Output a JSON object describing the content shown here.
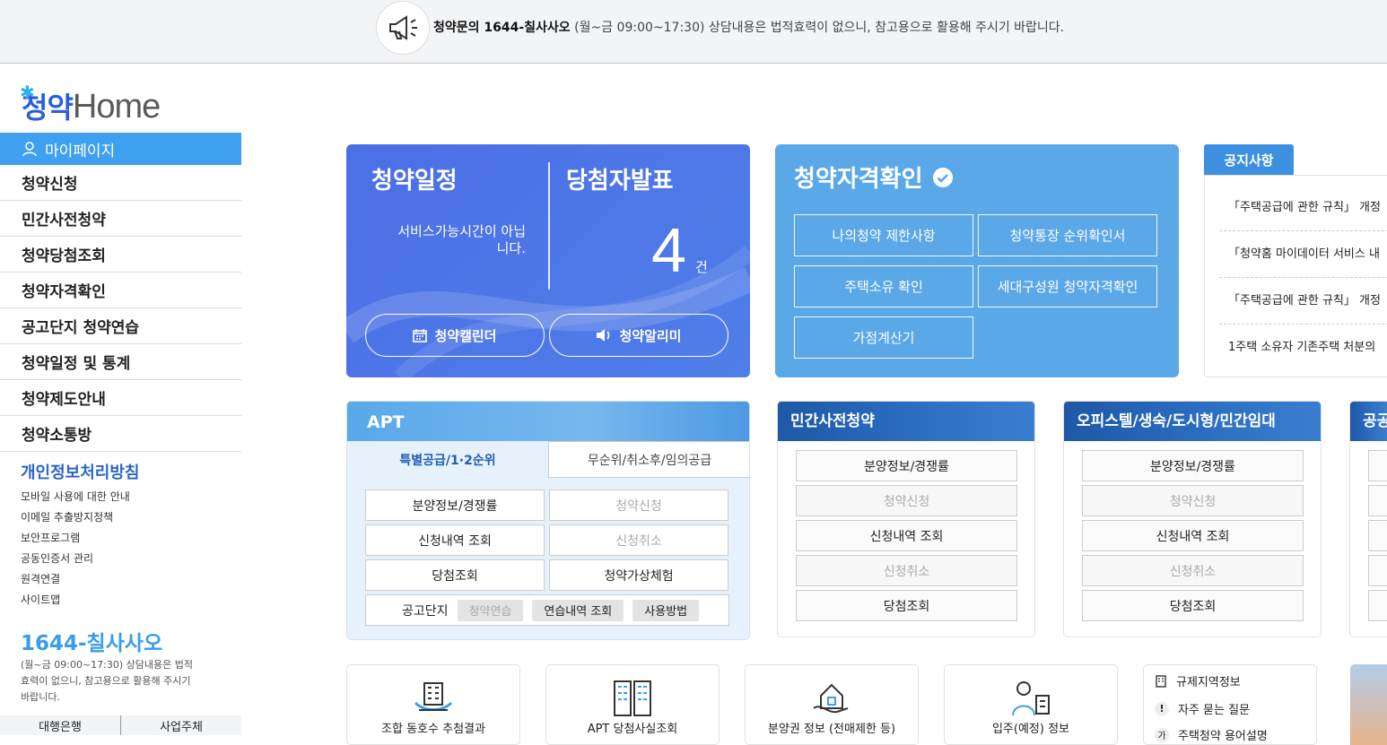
{
  "topbar": {
    "bold": "청약문의 1644-칠사사오",
    "rest": " (월~금 09:00~17:30) 상담내용은 법적효력이 없으니, 참고용으로 활용해 주시기 바랍니다.",
    "icon": "megaphone-icon"
  },
  "logo": {
    "korean": "청약",
    "english": "Home"
  },
  "sidebar": {
    "mypage": "마이페이지",
    "items": [
      "청약신청",
      "민간사전청약",
      "청약당첨조회",
      "청약자격확인",
      "공고단지 청약연습",
      "청약일정 및 통계",
      "청약제도안내",
      "청약소통방"
    ],
    "privacy": "개인정보처리방침",
    "links": [
      "모바일 사용에 대한 안내",
      "이메일 추출방지정책",
      "보안프로그램",
      "공동인증서 관리",
      "원격연결",
      "사이트맵"
    ],
    "phone": "1644-칠사사오",
    "phone_sub": "(월~금 09:00~17:30) 상담내용은 법적효력이 없으니, 참고용으로 활용해 주시기 바랍니다.",
    "bottom": [
      "대행은행",
      "사업주체"
    ]
  },
  "schedule_card": {
    "title1": "청약일정",
    "service_msg": "서비스가능시간이 아닙니다.",
    "title2": "당첨자발표",
    "count": "4",
    "count_unit": "건",
    "calendar_btn": "청약캘린더",
    "alarm_btn": "청약알리미"
  },
  "qualify_card": {
    "title": "청약자격확인",
    "buttons": [
      "나의청약 제한사항",
      "청약통장 순위확인서",
      "주택소유 확인",
      "세대구성원 청약자격확인",
      "가점계산기"
    ]
  },
  "notice": {
    "tab": "공지사항",
    "items": [
      "「주택공급에 관한 규칙」 개정",
      "「청약홈 마이데이터 서비스 내",
      "「주택공급에 관한 규칙」 개정",
      "1주택 소유자 기존주택 처분의"
    ]
  },
  "apt": {
    "title": "APT",
    "tab_on": "특별공급/1·2순위",
    "tab_off": "무순위/취소후/임의공급",
    "buttons": [
      "분양정보/경쟁률",
      "청약신청",
      "신청내역 조회",
      "신청취소",
      "당첨조회",
      "청약가상체험"
    ],
    "practice_label": "공고단지",
    "chips": [
      "청약연습",
      "연습내역 조회",
      "사용방법"
    ]
  },
  "pre_sale": {
    "title": "민간사전청약",
    "buttons": [
      "분양정보/경쟁률",
      "청약신청",
      "신청내역 조회",
      "신청취소",
      "당첨조회"
    ]
  },
  "officetel": {
    "title": "오피스텔/생숙/도시형/민간임대",
    "buttons": [
      "분양정보/경쟁률",
      "청약신청",
      "신청내역 조회",
      "신청취소",
      "당첨조회"
    ]
  },
  "public_rental": {
    "title": "공공"
  },
  "services": [
    "조합 동호수 추첨결과",
    "APT 당첨사실조회",
    "분양권 정보 (전매제한 등)",
    "입주(예정) 정보"
  ],
  "quick_links": [
    "규제지역정보",
    "자주 묻는 질문",
    "주택청약 용어설명"
  ],
  "colors": {
    "primary": "#4c6fe6",
    "sky": "#5ba8e8",
    "notice_tab": "#3d8fe0",
    "sidebar_active": "#3f9ff0"
  }
}
